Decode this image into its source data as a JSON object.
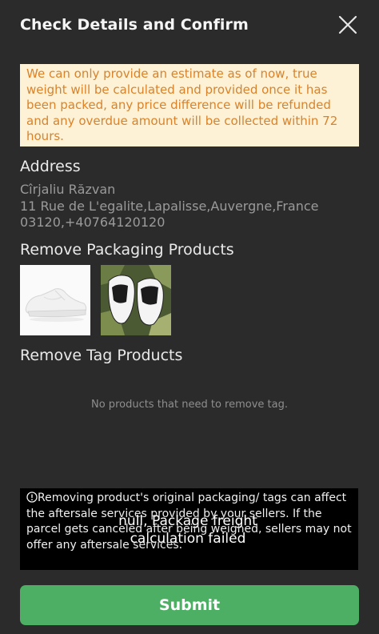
{
  "header": {
    "title": "Check Details and Confirm",
    "close_icon": "close-icon"
  },
  "notice": {
    "text": "We can only provide an estimate as of now, true weight will be calculated and provided once it has been packed, any price difference will be refunded and any overdue amount will be collected within 72 hours."
  },
  "address": {
    "title": "Address",
    "name": "Cîrjaliu Răzvan",
    "line1": "11 Rue de L'egalite,Lapalisse,Auvergne,France",
    "line2": "03120,+40764120120"
  },
  "remove_packaging": {
    "title": "Remove Packaging Products",
    "products": [
      {
        "image": "white-sneaker"
      },
      {
        "image": "black-white-sneakers"
      }
    ]
  },
  "remove_tag": {
    "title": "Remove Tag Products",
    "empty_text": "No products that need to remove tag."
  },
  "warning": {
    "icon": "info-circle-icon",
    "text": "Removing product's original packaging/ tags can affect the aftersale services provided by your sellers. If the parcel gets canceled after being weighed, sellers may not offer any aftersale services."
  },
  "toast": {
    "line1": "null, Package freight",
    "line2": "calculation failed"
  },
  "submit": {
    "label": "Submit"
  },
  "colors": {
    "background": "#2b2b2b",
    "notice_bg": "#fdf2d6",
    "notice_text": "#d9822b",
    "submit_bg": "#4caf63"
  }
}
